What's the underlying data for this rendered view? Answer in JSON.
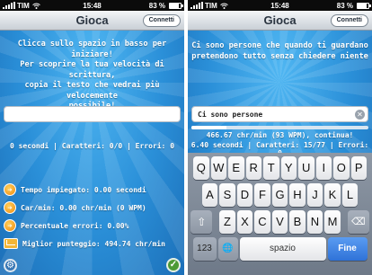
{
  "left": {
    "status": {
      "carrier": "TIM",
      "time": "15:48",
      "battery": "83 %"
    },
    "nav": {
      "title": "Gioca",
      "connect_label": "Connetti"
    },
    "prompt_lines": [
      "Clicca sullo spazio in basso per iniziare!",
      "Per scoprire la tua velocità di scrittura,",
      "copia il testo che vedrai più velocemente",
      "possibile!"
    ],
    "input_value": "",
    "stats_line": "0 secondi | Caratteri: 0/0 | Errori: 0",
    "stats": [
      {
        "label": "Tempo impiegato: 0.00 secondi",
        "icon": "arrow-right-icon"
      },
      {
        "label": "Car/min: 0.00 chr/min (0 WPM)",
        "icon": "arrow-right-icon"
      },
      {
        "label": "Percentuale errori: 0.00%",
        "icon": "arrow-right-icon"
      },
      {
        "label": "Miglior punteggio: 494.74 chr/min",
        "icon": "envelope-icon"
      }
    ]
  },
  "right": {
    "status": {
      "carrier": "TIM",
      "time": "15:48",
      "battery": "83 %"
    },
    "nav": {
      "title": "Gioca",
      "connect_label": "Connetti"
    },
    "prompt_lines": [
      "Ci sono persone che quando ti guardano",
      "pretendono tutto senza chiedere niente"
    ],
    "input_value": "Ci sono persone",
    "progress": 0.2,
    "rate_line": "466.67 chr/min (93 WPM), continua!",
    "stats_line": "6.40 secondi | Caratteri: 15/77 | Errori: 0",
    "keyboard": {
      "row1": [
        "Q",
        "W",
        "E",
        "R",
        "T",
        "Y",
        "U",
        "I",
        "O",
        "P"
      ],
      "row2": [
        "A",
        "S",
        "D",
        "F",
        "G",
        "H",
        "J",
        "K",
        "L"
      ],
      "row3": [
        "Z",
        "X",
        "C",
        "V",
        "B",
        "N",
        "M"
      ],
      "shift": "⇧",
      "delete": "⌫",
      "numbers": "123",
      "globe": "🌐",
      "space": "spazio",
      "done": "Fine"
    }
  }
}
